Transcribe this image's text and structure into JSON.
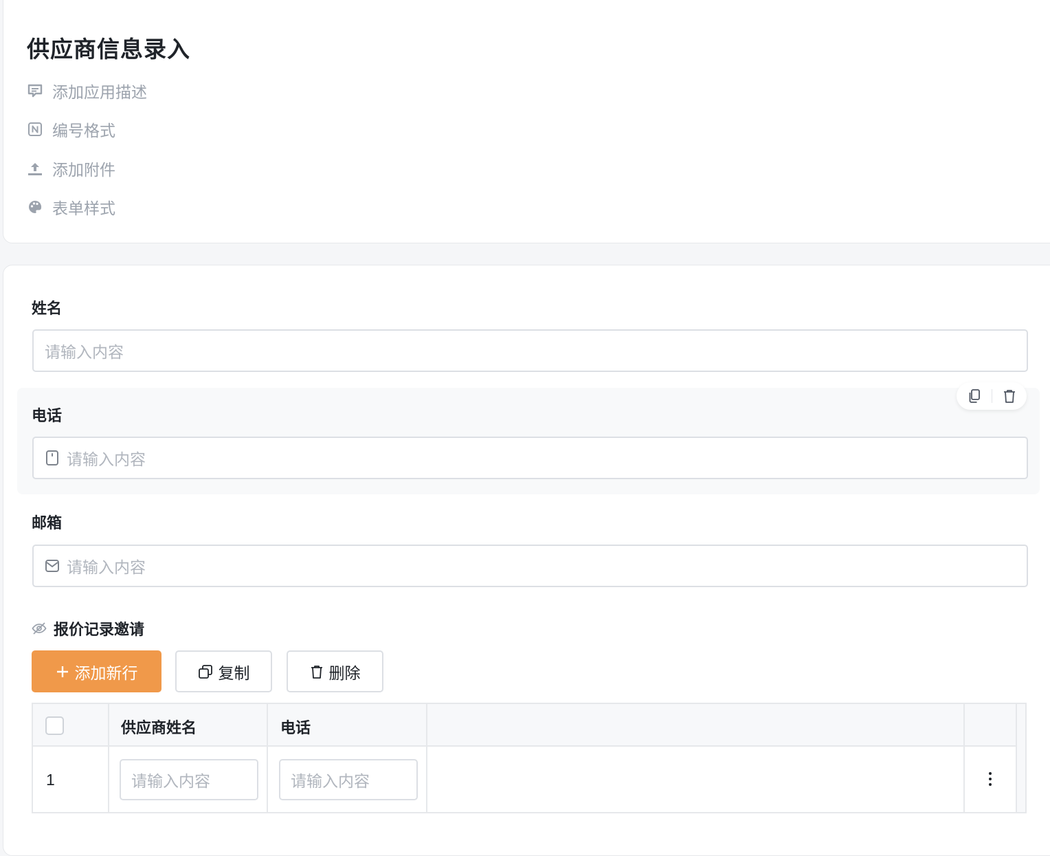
{
  "header": {
    "title": "供应商信息录入",
    "menu": [
      {
        "icon": "comment-icon",
        "label": "添加应用描述"
      },
      {
        "icon": "numbering-icon",
        "label": "编号格式"
      },
      {
        "icon": "upload-icon",
        "label": "添加附件"
      },
      {
        "icon": "palette-icon",
        "label": "表单样式"
      }
    ]
  },
  "form": {
    "name": {
      "label": "姓名",
      "placeholder": "请输入内容"
    },
    "phone": {
      "label": "电话",
      "placeholder": "请输入内容",
      "icon": "phone-icon"
    },
    "email": {
      "label": "邮箱",
      "placeholder": "请输入内容",
      "icon": "mail-icon"
    },
    "field_tools": [
      "copy-icon",
      "trash-icon"
    ]
  },
  "subtable": {
    "title": "报价记录邀请",
    "title_icon": "eye-off-icon",
    "add_label": "添加新行",
    "copy_label": "复制",
    "delete_label": "删除",
    "columns": [
      "供应商姓名",
      "电话"
    ],
    "rows": [
      {
        "index": "1",
        "supplier_placeholder": "请输入内容",
        "phone_placeholder": "请输入内容"
      }
    ]
  },
  "colors": {
    "primary": "#f0994a",
    "muted_text": "#9ca3ad",
    "placeholder": "#b1b6be",
    "border": "#dcdfe4"
  }
}
